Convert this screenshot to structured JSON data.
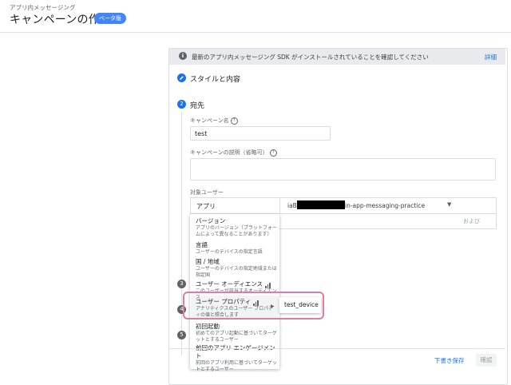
{
  "header": {
    "breadcrumb": "アプリ内メッセージング",
    "title": "キャンペーンの作成",
    "badge": "ベータ版"
  },
  "banner": {
    "text": "最新のアプリ内メッセージング SDK がインストールされていることを確認してください",
    "link": "詳細"
  },
  "steps": {
    "step1": {
      "label": "スタイルと内容"
    },
    "step2": {
      "number": "2",
      "label": "宛先"
    },
    "step3": {
      "number": "3"
    },
    "step4": {
      "number": "4"
    },
    "step5": {
      "number": "5"
    }
  },
  "form": {
    "campaign_name_label": "キャンペーン名",
    "campaign_name_value": "test",
    "campaign_desc_label": "キャンペーンの説明（省略可）",
    "target_label": "対象ユーザー",
    "app_cell": "アプリ",
    "app_prefix": "iaB-",
    "app_suffix": "in-app-messaging-practice",
    "and_label": "および"
  },
  "menu": {
    "items": [
      {
        "title": "バージョン",
        "desc": "アプリのバージョン（プラットフォームによって異なることがあります）"
      },
      {
        "title": "言語",
        "desc": "ユーザーのデバイスの指定言語"
      },
      {
        "title": "国 / 地域",
        "desc": "ユーザーのデバイスの指定地域または指定国"
      },
      {
        "title": "ユーザー オーディエンス",
        "desc": "このユーザーが該当するオーディエンス"
      },
      {
        "title": "ユーザー プロパティ",
        "desc": "アナリティクスのユーザー プロパティの値と照合します"
      },
      {
        "title": "初回起動",
        "desc": "初めてのアプリ起動に基づいてターゲットとするユーザー"
      },
      {
        "title": "前回のアプリ エンゲージメント",
        "desc": "前回のアプリ利用に基づいてターゲットとするユーザー"
      }
    ],
    "submenu_item": "test_device"
  },
  "footer": {
    "draft_button": "下書き保存",
    "confirm_button": "確認"
  },
  "colors": {
    "accent": "#1a73e8",
    "highlight": "#e07aa7"
  }
}
